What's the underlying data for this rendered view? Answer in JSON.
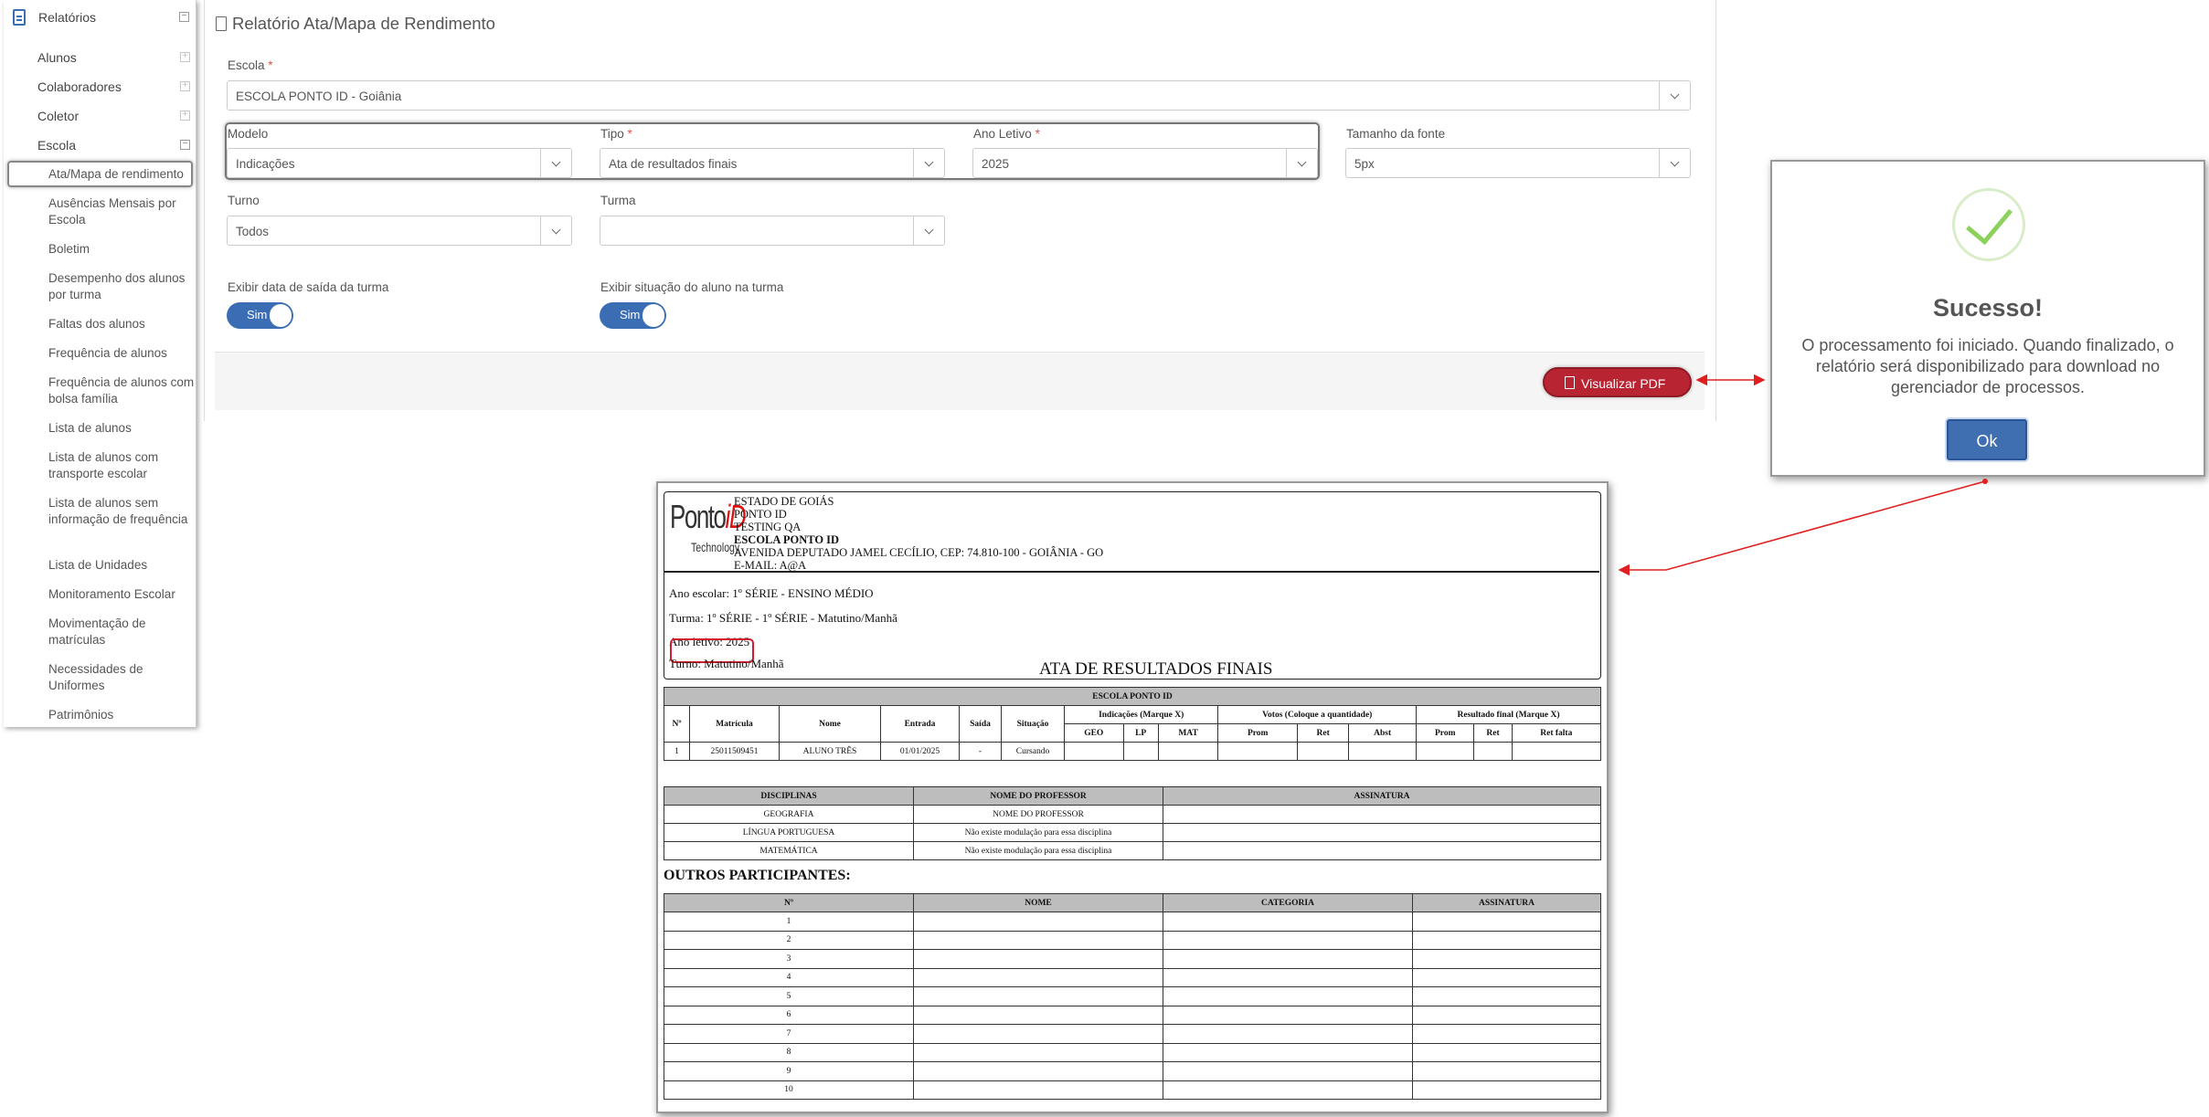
{
  "sidebar": {
    "title": "Relatórios",
    "groups": [
      {
        "label": "Alunos",
        "toggle": "+"
      },
      {
        "label": "Colaboradores",
        "toggle": "+"
      },
      {
        "label": "Coletor",
        "toggle": "+"
      },
      {
        "label": "Escola",
        "toggle": "−"
      }
    ],
    "items": [
      "Ata/Mapa de rendimento",
      "Ausências Mensais por Escola",
      "Boletim",
      "Desempenho dos alunos por turma",
      "Faltas dos alunos",
      "Frequência de alunos",
      "Frequência de alunos com bolsa família",
      "Lista de alunos",
      "Lista de alunos com transporte escolar",
      "Lista de alunos sem informação de frequência",
      "Lista de Unidades",
      "Monitoramento Escolar",
      "Movimentação de matrículas",
      "Necessidades de Uniformes",
      "Patrimônios"
    ]
  },
  "form": {
    "title": "Relatório Ata/Mapa de Rendimento",
    "escola_label": "Escola",
    "escola_value": "ESCOLA PONTO ID - Goiânia",
    "modelo_label": "Modelo",
    "modelo_value": "Indicações",
    "tipo_label": "Tipo",
    "tipo_value": "Ata de resultados finais",
    "ano_label": "Ano Letivo",
    "ano_value": "2025",
    "fonte_label": "Tamanho da fonte",
    "fonte_value": "5px",
    "turno_label": "Turno",
    "turno_value": "Todos",
    "turma_label": "Turma",
    "turma_value": "",
    "saida_label": "Exibir data de saída da turma",
    "saida_toggle": "Sim",
    "situacao_label": "Exibir situação do aluno na turma",
    "situacao_toggle": "Sim",
    "required_mark": "*",
    "pdf_button": "Visualizar PDF"
  },
  "modal": {
    "title": "Sucesso!",
    "message": "O processamento foi iniciado. Quando finalizado, o relatório será disponibilizado para download no gerenciador de processos.",
    "ok": "Ok"
  },
  "pdf": {
    "logo_main": "Ponto",
    "logo_id": "iD",
    "logo_sub": "Technology",
    "header_lines": [
      "ESTADO DE GOIÁS",
      "PONTO ID",
      "TESTING QA"
    ],
    "header_school": "ESCOLA PONTO ID",
    "header_address": "AVENIDA DEPUTADO JAMEL CECÍLIO, CEP: 74.810-100 - GOIÂNIA - GO",
    "header_email": "E-MAIL: A@A",
    "ano_escolar": "Ano escolar: 1º SÉRIE - ENSINO MÉDIO",
    "turma": "Turma: 1º SÉRIE - 1º SÉRIE - Matutino/Manhã",
    "ano_letivo": "Ano letivo: 2025",
    "turno": "Turno: Matutino/Manhã",
    "doc_title": "ATA DE RESULTADOS FINAIS",
    "table_school": "ESCOLA PONTO ID",
    "cols": {
      "n": "Nº",
      "matricula": "Matrícula",
      "nome": "Nome",
      "entrada": "Entrada",
      "saida": "Saída",
      "situacao": "Situação",
      "indicacoes": "Indicações (Marque X)",
      "votos": "Votos (Coloque a quantidade)",
      "resultado": "Resultado final (Marque X)"
    },
    "sub_cols": [
      "GEO",
      "LP",
      "MAT",
      "Prom",
      "Ret",
      "Abst",
      "Prom",
      "Ret",
      "Ret falta"
    ],
    "student": {
      "n": "1",
      "matricula": "25011509451",
      "nome": "ALUNO TRÊS",
      "entrada": "01/01/2025",
      "saida": "-",
      "situacao": "Cursando"
    },
    "disc_headers": [
      "DISCIPLINAS",
      "NOME DO PROFESSOR",
      "ASSINATURA"
    ],
    "disciplinas": [
      {
        "nome": "GEOGRAFIA",
        "professor": "NOME DO PROFESSOR"
      },
      {
        "nome": "LÍNGUA PORTUGUESA",
        "professor": "Não existe modulação para essa disciplina"
      },
      {
        "nome": "MATEMÁTICA",
        "professor": "Não existe modulação para essa disciplina"
      }
    ],
    "outros_title": "OUTROS PARTICIPANTES:",
    "outros_headers": [
      "Nº",
      "NOME",
      "CATEGORIA",
      "ASSINATURA"
    ],
    "outros_rows": [
      "1",
      "2",
      "3",
      "4",
      "5",
      "6",
      "7",
      "8",
      "9",
      "10"
    ]
  }
}
